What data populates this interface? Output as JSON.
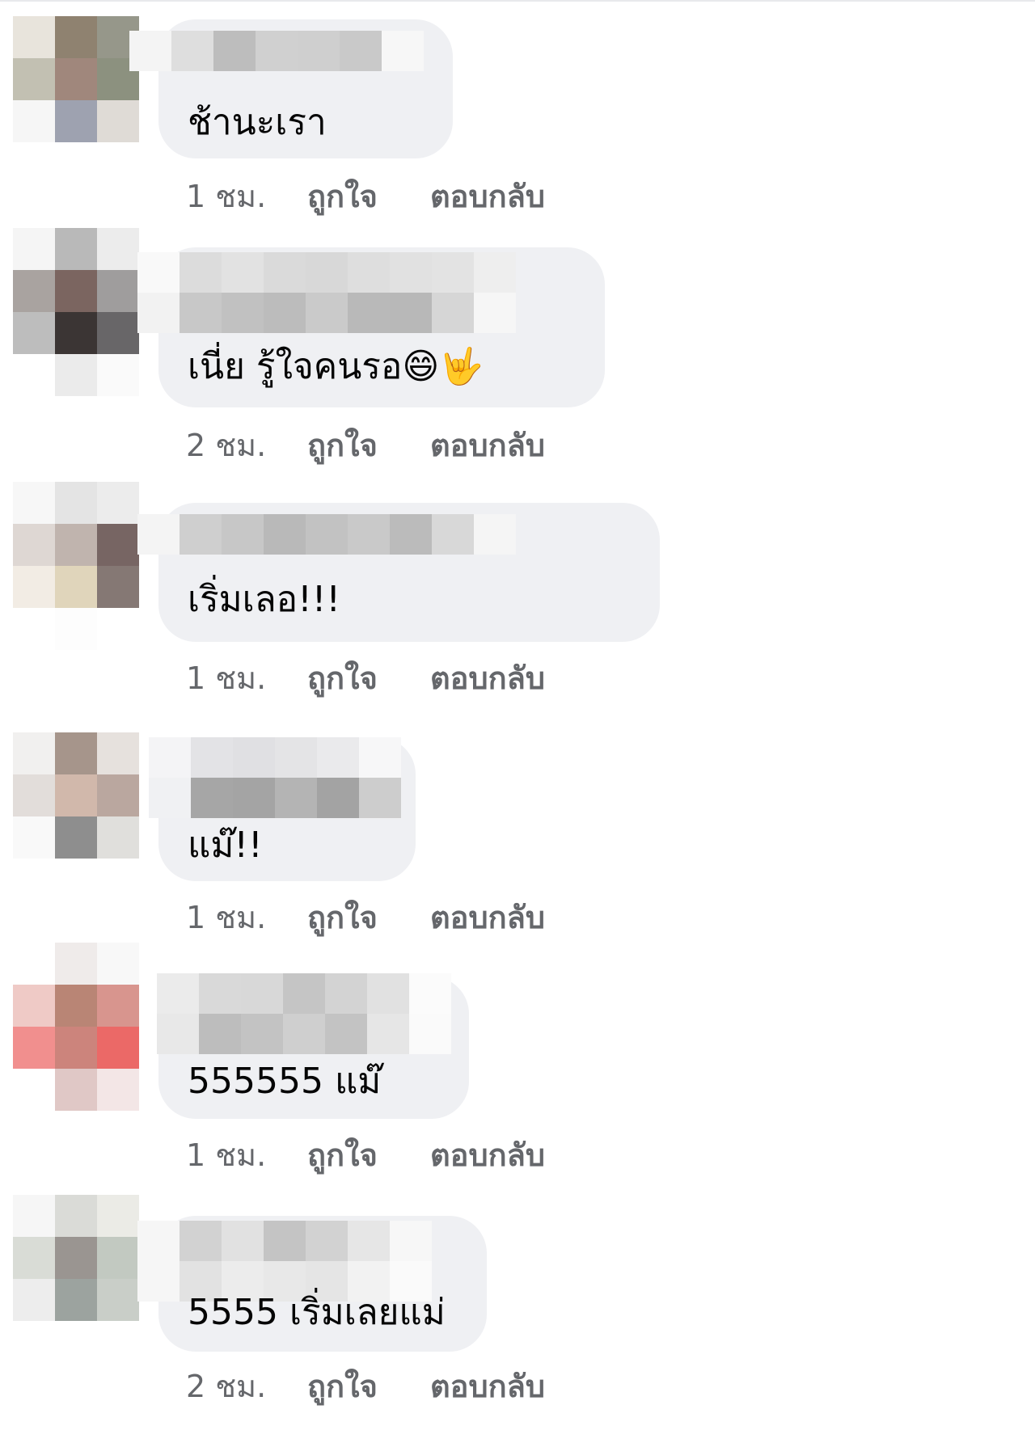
{
  "comments": [
    {
      "text": "ช้านะเรา",
      "time": "1 ชม.",
      "like": "ถูกใจ",
      "reply": "ตอบกลับ",
      "avatar_colors": [
        "#e8e4dc",
        "#8f8270",
        "#96978a",
        "#c2c0b2",
        "#a0877c",
        "#8c917f",
        "#f6f6f6",
        "#9ea2b0",
        "#dfdbd6",
        "#ffffff",
        "#ffffff",
        "#ffffff"
      ],
      "name_colors": [
        [
          "#f4f4f4",
          "#dedede",
          "#bdbdbd",
          "#d0d0d0",
          "#cfcfcf",
          "#c9c9c9",
          "#f7f7f7"
        ]
      ]
    },
    {
      "text": "เนี่ย รู้ใจคนรอ😄🤟",
      "time": "2 ชม.",
      "like": "ถูกใจ",
      "reply": "ตอบกลับ",
      "avatar_colors": [
        "#f5f5f5",
        "#b9b9b9",
        "#ececec",
        "#a9a3a0",
        "#7b6560",
        "#9f9d9d",
        "#bdbdbd",
        "#3b3534",
        "#686668",
        "#ffffff",
        "#ebebeb",
        "#fafafa"
      ],
      "name_colors": [
        [
          "#f9f9f9",
          "#dcdcdc",
          "#e2e2e2",
          "#dadada",
          "#d8d8d8",
          "#dedede",
          "#e1e1e1",
          "#e3e3e3",
          "#eeeeee"
        ],
        [
          "#f2f2f2",
          "#c8c8c8",
          "#c1c1c1",
          "#bcbcbc",
          "#cacaca",
          "#b9b9b9",
          "#b8b8b8",
          "#d6d6d6",
          "#f6f6f6"
        ]
      ]
    },
    {
      "text": "เริ่มเลอ!!!",
      "time": "1 ชม.",
      "like": "ถูกใจ",
      "reply": "ตอบกลับ",
      "avatar_colors": [
        "#f7f7f7",
        "#e4e4e4",
        "#ececec",
        "#ded7d3",
        "#c0b4ae",
        "#776563",
        "#f2ece4",
        "#e0d5bb",
        "#857874",
        "#ffffff",
        "#fdfdfd",
        "#ffffff"
      ],
      "name_colors": [
        [
          "#f4f4f4",
          "#cfcfcf",
          "#c7c7c7",
          "#b9b9b9",
          "#c2c2c2",
          "#c9c9c9",
          "#bbbbbb",
          "#d8d8d8",
          "#f5f5f5"
        ]
      ]
    },
    {
      "text": "แม๊!!",
      "time": "1 ชม.",
      "like": "ถูกใจ",
      "reply": "ตอบกลับ",
      "avatar_colors": [
        "#f1f0ef",
        "#a6958b",
        "#e6e1dd",
        "#e2ddda",
        "#d1b8ab",
        "#baa79f",
        "#f9f9f9",
        "#8e8e8e",
        "#e0dfdc",
        "#ffffff",
        "#ffffff",
        "#ffffff"
      ],
      "name_colors": [
        [
          "#f4f4f6",
          "#e3e3e6",
          "#e0e0e3",
          "#e4e4e6",
          "#eaeaec",
          "#f7f7f8"
        ],
        [
          "#f0f1f3",
          "#a6a6a6",
          "#a4a4a4",
          "#b4b4b4",
          "#a3a3a3",
          "#cdcdcd"
        ]
      ]
    },
    {
      "text": "555555 แม๊",
      "time": "1 ชม.",
      "like": "ถูกใจ",
      "reply": "ตอบกลับ",
      "avatar_colors": [
        "#ffffff",
        "#efebea",
        "#f8f8f8",
        "#efcac6",
        "#b98575",
        "#d8958e",
        "#f18f8e",
        "#cc847c",
        "#eb6967",
        "#ffffff",
        "#e0c8c6",
        "#f3e6e6"
      ],
      "name_colors": [
        [
          "#ebebeb",
          "#d9d9d9",
          "#d8d8d8",
          "#c5c5c5",
          "#d3d3d3",
          "#e1e1e1",
          "#fbfbfb"
        ],
        [
          "#e8e8e8",
          "#bdbdbd",
          "#c3c3c3",
          "#cfcfcf",
          "#c3c3c3",
          "#e6e6e6",
          "#fafafa"
        ]
      ]
    },
    {
      "text": "5555 เริ่มเลยแม่",
      "time": "2 ชม.",
      "like": "ถูกใจ",
      "reply": "ตอบกลับ",
      "avatar_colors": [
        "#f6f6f6",
        "#dadbd7",
        "#ebebe6",
        "#d9dcd6",
        "#9a9591",
        "#c2c9c1",
        "#ededed",
        "#9ca39f",
        "#c9cec8",
        "#ffffff",
        "#ffffff",
        "#ffffff"
      ],
      "name_colors": [
        [
          "#f6f6f6",
          "#d2d2d2",
          "#e1e1e1",
          "#c4c4c4",
          "#d2d2d2",
          "#e6e6e6",
          "#f7f7f7"
        ],
        [
          "#f6f6f6",
          "#e2e2e2",
          "#ececec",
          "#e8e8e8",
          "#e5e5e5",
          "#f2f2f2",
          "#fafafa"
        ]
      ]
    }
  ]
}
